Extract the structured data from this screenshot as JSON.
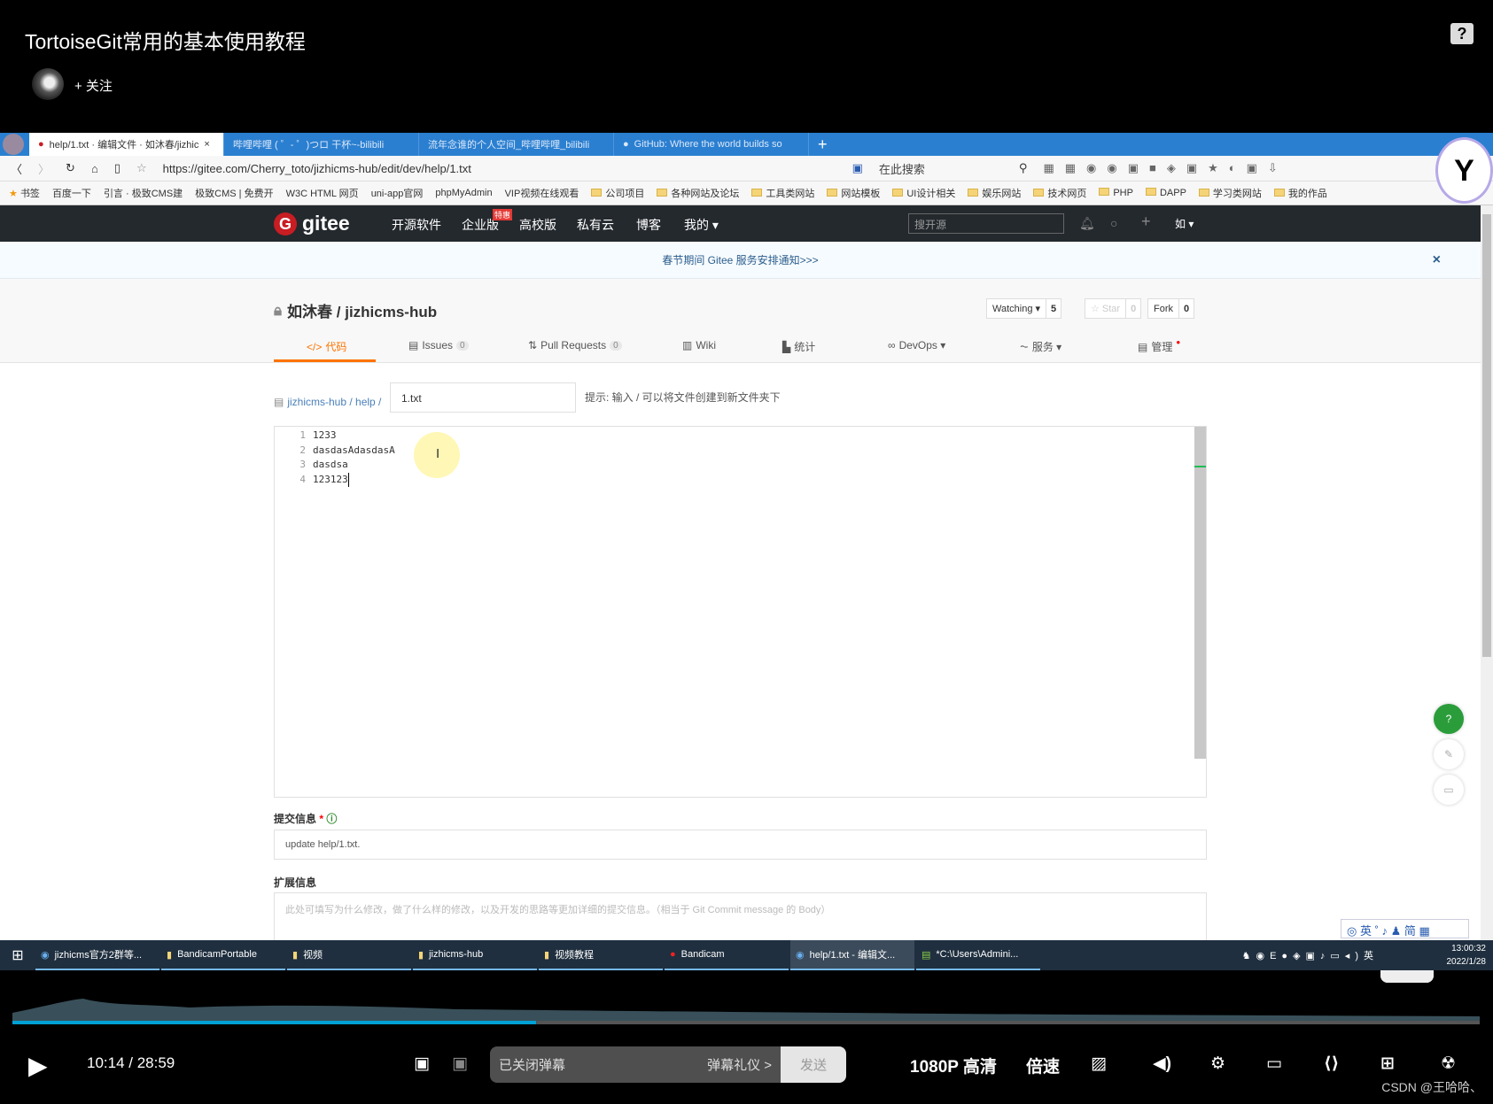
{
  "video": {
    "title": "TortoiseGit常用的基本使用教程",
    "follow": "+ 关注",
    "help": "?"
  },
  "browser": {
    "tabs": [
      {
        "label": "help/1.txt · 编辑文件 · 如沐春/jizhic",
        "active": true
      },
      {
        "label": "哔哩哔哩 ( ゜- ゜)つロ 干杯~-bilibili"
      },
      {
        "label": "流年念谁的个人空间_哔哩哔哩_bilibili"
      },
      {
        "label": "GitHub: Where the world builds so"
      }
    ],
    "new_tab": "+",
    "url": "https://gitee.com/Cherry_toto/jizhicms-hub/edit/dev/help/1.txt",
    "search_placeholder": "在此搜索",
    "bookmarks": [
      "书签",
      "百度一下",
      "引言 · 极致CMS建",
      "极致CMS | 免费开",
      "W3C HTML 网页",
      "uni-app官网",
      "phpMyAdmin",
      "VIP视频在线观看",
      "公司项目",
      "各种网站及论坛",
      "工具类网站",
      "网站模板",
      "UI设计相关",
      "娱乐网站",
      "技术网页",
      "PHP",
      "DAPP",
      "学习类网站",
      "我的作品"
    ]
  },
  "gitee": {
    "logo": "gitee",
    "nav": [
      "开源软件",
      "企业版",
      "高校版",
      "私有云",
      "博客",
      "我的 ▾"
    ],
    "badge": "特惠",
    "search_placeholder": "搜开源",
    "user": "如 ▾",
    "notice": "春节期间 Gitee 服务安排通知>>>",
    "close": "×",
    "repo": "如沐春 / jizhicms-hub",
    "watch": {
      "label": "Watching ▾",
      "count": "5"
    },
    "star": {
      "label": "☆ Star",
      "count": "0"
    },
    "fork": {
      "label": "Fork",
      "count": "0"
    },
    "tabs": [
      {
        "label": "代码",
        "active": true
      },
      {
        "label": "Issues",
        "count": "0"
      },
      {
        "label": "Pull Requests",
        "count": "0"
      },
      {
        "label": "Wiki"
      },
      {
        "label": "统计"
      },
      {
        "label": "DevOps ▾"
      },
      {
        "label": "服务 ▾"
      },
      {
        "label": "管理"
      }
    ],
    "breadcrumb": "jizhicms-hub / help /",
    "filename": "1.txt",
    "hint": "提示: 输入 / 可以将文件创建到新文件夹下",
    "lines": [
      {
        "n": "1",
        "t": "1233"
      },
      {
        "n": "2",
        "t": "dasdasAdasdasA"
      },
      {
        "n": "3",
        "t": "dasdsa"
      },
      {
        "n": "4",
        "t": "123123"
      }
    ],
    "commit_label": "提交信息",
    "required": "*",
    "commit_value": "update help/1.txt.",
    "ext_label": "扩展信息",
    "ext_placeholder": "此处可填写为什么修改，做了什么样的修改，以及开发的思路等更加详细的提交信息。（相当于 Git Commit message 的 Body）"
  },
  "taskbar": {
    "items": [
      {
        "label": "jizhicms官方2群等..."
      },
      {
        "label": "BandicamPortable"
      },
      {
        "label": "视频"
      },
      {
        "label": "jizhicms-hub"
      },
      {
        "label": "视频教程"
      },
      {
        "label": "Bandicam"
      },
      {
        "label": "help/1.txt - 编辑文...",
        "active": true
      },
      {
        "label": "*C:\\Users\\Admini..."
      }
    ],
    "time": "13:00:32",
    "date": "2022/1/28",
    "ime": "英"
  },
  "player": {
    "current": "10:14",
    "total": "28:59",
    "progress": 0.357,
    "danmaku_placeholder": "已关闭弹幕",
    "etiquette": "弹幕礼仪 >",
    "send": "发送",
    "quality": "1080P 高清",
    "speed": "倍速",
    "watermark": "CSDN @王哈哈、"
  }
}
